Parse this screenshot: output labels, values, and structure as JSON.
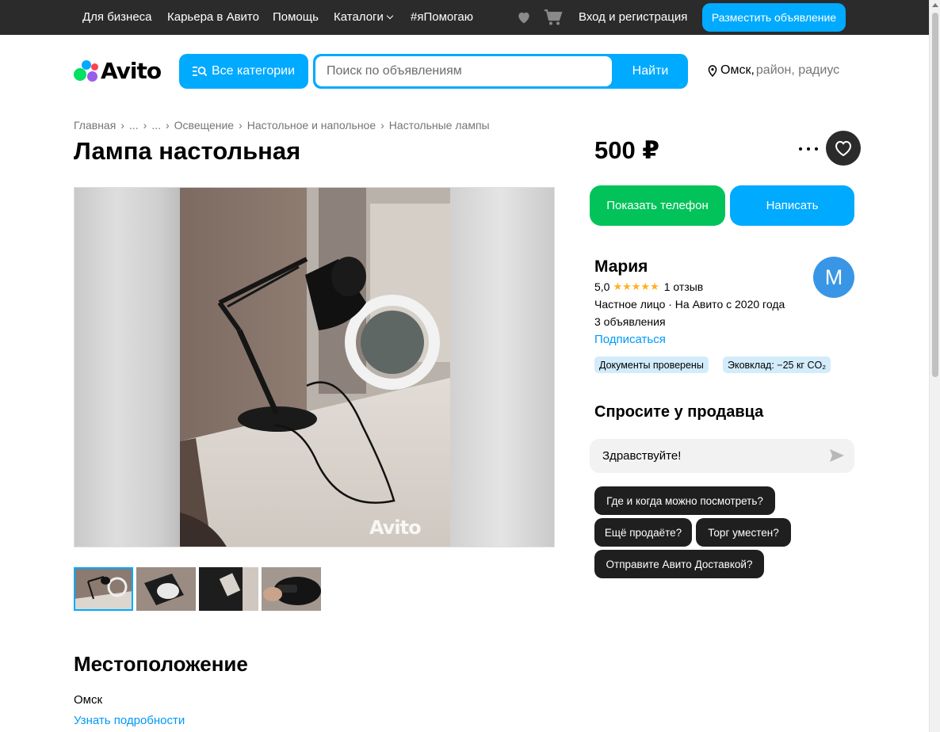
{
  "topbar": {
    "links": [
      "Для бизнеса",
      "Карьера в Авито",
      "Помощь",
      "Каталоги",
      "#яПомогаю"
    ],
    "login": "Вход и регистрация",
    "post_button": "Разместить объявление",
    "icons": [
      "heart-icon",
      "cart-icon"
    ]
  },
  "header": {
    "logo": "Avito",
    "categories_button": "Все категории",
    "search_placeholder": "Поиск по объявлениям",
    "search_button": "Найти",
    "location_city": "Омск,",
    "location_rest": "район, радиус"
  },
  "breadcrumb": [
    "Главная",
    "...",
    "...",
    "Освещение",
    "Настольное и напольное",
    "Настольные лампы"
  ],
  "listing": {
    "title": "Лампа настольная",
    "price": "500 ₽",
    "watermark": "Avito",
    "thumbnail_count": 4
  },
  "actions": {
    "phone_button": "Показать телефон",
    "write_button": "Написать"
  },
  "seller": {
    "name": "Мария",
    "rating": "5,0",
    "stars": "★★★★★",
    "reviews": "1 отзыв",
    "type_line": "Частное лицо · На Авито с 2020 года",
    "listings": "3 объявления",
    "subscribe": "Подписаться",
    "avatar_letter": "М",
    "badges": [
      "Документы проверены",
      "Эковклад: −25 кг CO₂"
    ]
  },
  "ask": {
    "title": "Спросите у продавца",
    "input_value": "Здравствуйте!",
    "chips": [
      "Где и когда можно посмотреть?",
      "Ещё продаёте?",
      "Торг уместен?",
      "Отправите Авито Доставкой?"
    ]
  },
  "location": {
    "title": "Местоположение",
    "city": "Омск",
    "more": "Узнать подробности"
  },
  "colors": {
    "accent": "#00aaff",
    "green": "#02c35a",
    "dark": "#2b2b2b",
    "link": "#0099f7"
  }
}
